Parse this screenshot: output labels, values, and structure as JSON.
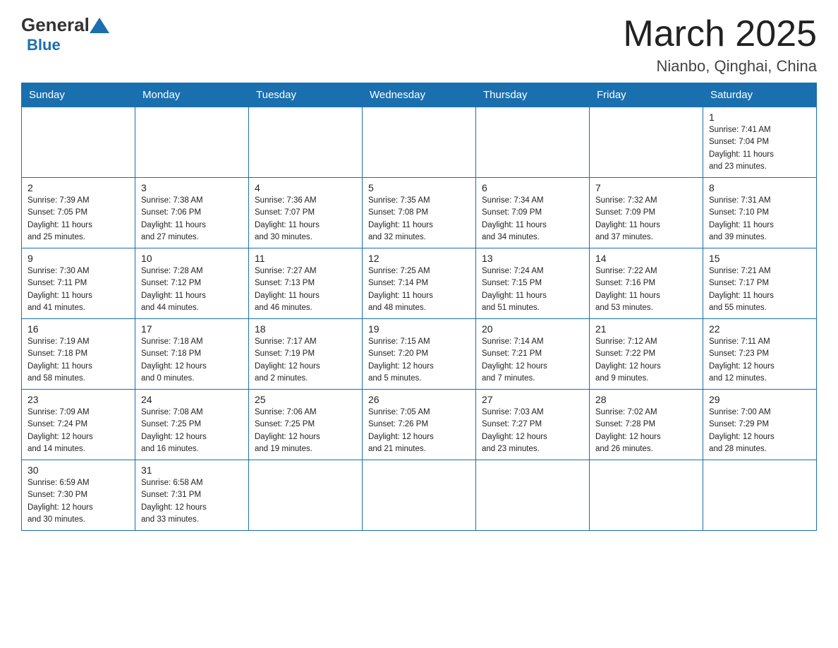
{
  "header": {
    "logo_general": "General",
    "logo_blue": "Blue",
    "title": "March 2025",
    "subtitle": "Nianbo, Qinghai, China"
  },
  "days_of_week": [
    "Sunday",
    "Monday",
    "Tuesday",
    "Wednesday",
    "Thursday",
    "Friday",
    "Saturday"
  ],
  "weeks": [
    [
      {
        "day": "",
        "info": ""
      },
      {
        "day": "",
        "info": ""
      },
      {
        "day": "",
        "info": ""
      },
      {
        "day": "",
        "info": ""
      },
      {
        "day": "",
        "info": ""
      },
      {
        "day": "",
        "info": ""
      },
      {
        "day": "1",
        "info": "Sunrise: 7:41 AM\nSunset: 7:04 PM\nDaylight: 11 hours\nand 23 minutes."
      }
    ],
    [
      {
        "day": "2",
        "info": "Sunrise: 7:39 AM\nSunset: 7:05 PM\nDaylight: 11 hours\nand 25 minutes."
      },
      {
        "day": "3",
        "info": "Sunrise: 7:38 AM\nSunset: 7:06 PM\nDaylight: 11 hours\nand 27 minutes."
      },
      {
        "day": "4",
        "info": "Sunrise: 7:36 AM\nSunset: 7:07 PM\nDaylight: 11 hours\nand 30 minutes."
      },
      {
        "day": "5",
        "info": "Sunrise: 7:35 AM\nSunset: 7:08 PM\nDaylight: 11 hours\nand 32 minutes."
      },
      {
        "day": "6",
        "info": "Sunrise: 7:34 AM\nSunset: 7:09 PM\nDaylight: 11 hours\nand 34 minutes."
      },
      {
        "day": "7",
        "info": "Sunrise: 7:32 AM\nSunset: 7:09 PM\nDaylight: 11 hours\nand 37 minutes."
      },
      {
        "day": "8",
        "info": "Sunrise: 7:31 AM\nSunset: 7:10 PM\nDaylight: 11 hours\nand 39 minutes."
      }
    ],
    [
      {
        "day": "9",
        "info": "Sunrise: 7:30 AM\nSunset: 7:11 PM\nDaylight: 11 hours\nand 41 minutes."
      },
      {
        "day": "10",
        "info": "Sunrise: 7:28 AM\nSunset: 7:12 PM\nDaylight: 11 hours\nand 44 minutes."
      },
      {
        "day": "11",
        "info": "Sunrise: 7:27 AM\nSunset: 7:13 PM\nDaylight: 11 hours\nand 46 minutes."
      },
      {
        "day": "12",
        "info": "Sunrise: 7:25 AM\nSunset: 7:14 PM\nDaylight: 11 hours\nand 48 minutes."
      },
      {
        "day": "13",
        "info": "Sunrise: 7:24 AM\nSunset: 7:15 PM\nDaylight: 11 hours\nand 51 minutes."
      },
      {
        "day": "14",
        "info": "Sunrise: 7:22 AM\nSunset: 7:16 PM\nDaylight: 11 hours\nand 53 minutes."
      },
      {
        "day": "15",
        "info": "Sunrise: 7:21 AM\nSunset: 7:17 PM\nDaylight: 11 hours\nand 55 minutes."
      }
    ],
    [
      {
        "day": "16",
        "info": "Sunrise: 7:19 AM\nSunset: 7:18 PM\nDaylight: 11 hours\nand 58 minutes."
      },
      {
        "day": "17",
        "info": "Sunrise: 7:18 AM\nSunset: 7:18 PM\nDaylight: 12 hours\nand 0 minutes."
      },
      {
        "day": "18",
        "info": "Sunrise: 7:17 AM\nSunset: 7:19 PM\nDaylight: 12 hours\nand 2 minutes."
      },
      {
        "day": "19",
        "info": "Sunrise: 7:15 AM\nSunset: 7:20 PM\nDaylight: 12 hours\nand 5 minutes."
      },
      {
        "day": "20",
        "info": "Sunrise: 7:14 AM\nSunset: 7:21 PM\nDaylight: 12 hours\nand 7 minutes."
      },
      {
        "day": "21",
        "info": "Sunrise: 7:12 AM\nSunset: 7:22 PM\nDaylight: 12 hours\nand 9 minutes."
      },
      {
        "day": "22",
        "info": "Sunrise: 7:11 AM\nSunset: 7:23 PM\nDaylight: 12 hours\nand 12 minutes."
      }
    ],
    [
      {
        "day": "23",
        "info": "Sunrise: 7:09 AM\nSunset: 7:24 PM\nDaylight: 12 hours\nand 14 minutes."
      },
      {
        "day": "24",
        "info": "Sunrise: 7:08 AM\nSunset: 7:25 PM\nDaylight: 12 hours\nand 16 minutes."
      },
      {
        "day": "25",
        "info": "Sunrise: 7:06 AM\nSunset: 7:25 PM\nDaylight: 12 hours\nand 19 minutes."
      },
      {
        "day": "26",
        "info": "Sunrise: 7:05 AM\nSunset: 7:26 PM\nDaylight: 12 hours\nand 21 minutes."
      },
      {
        "day": "27",
        "info": "Sunrise: 7:03 AM\nSunset: 7:27 PM\nDaylight: 12 hours\nand 23 minutes."
      },
      {
        "day": "28",
        "info": "Sunrise: 7:02 AM\nSunset: 7:28 PM\nDaylight: 12 hours\nand 26 minutes."
      },
      {
        "day": "29",
        "info": "Sunrise: 7:00 AM\nSunset: 7:29 PM\nDaylight: 12 hours\nand 28 minutes."
      }
    ],
    [
      {
        "day": "30",
        "info": "Sunrise: 6:59 AM\nSunset: 7:30 PM\nDaylight: 12 hours\nand 30 minutes."
      },
      {
        "day": "31",
        "info": "Sunrise: 6:58 AM\nSunset: 7:31 PM\nDaylight: 12 hours\nand 33 minutes."
      },
      {
        "day": "",
        "info": ""
      },
      {
        "day": "",
        "info": ""
      },
      {
        "day": "",
        "info": ""
      },
      {
        "day": "",
        "info": ""
      },
      {
        "day": "",
        "info": ""
      }
    ]
  ]
}
